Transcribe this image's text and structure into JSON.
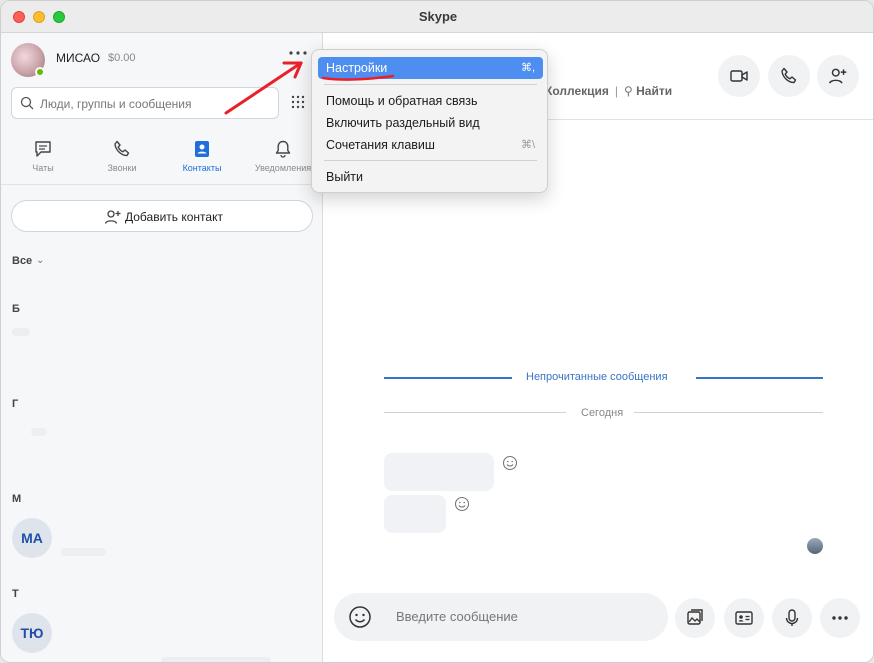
{
  "window": {
    "title": "Skype"
  },
  "profile": {
    "name": "МИСАО",
    "credit": "$0.00"
  },
  "search": {
    "placeholder": "Люди, группы и сообщения"
  },
  "nav": {
    "chats": "Чаты",
    "calls": "Звонки",
    "contacts": "Контакты",
    "notifications": "Уведомления"
  },
  "contacts": {
    "add_label": "Добавить контакт",
    "filter": "Все",
    "letters": [
      "Б",
      "Г",
      "М",
      "Т"
    ],
    "avatars": [
      "МА",
      "ТЮ"
    ]
  },
  "header": {
    "collection": "Коллекция",
    "find": "Найти"
  },
  "chat": {
    "unread_divider": "Непрочитанные сообщения",
    "today_divider": "Сегодня"
  },
  "composer": {
    "placeholder": "Введите сообщение"
  },
  "menu": {
    "settings": "Настройки",
    "settings_shortcut": "⌘,",
    "help": "Помощь и обратная связь",
    "split_view": "Включить раздельный вид",
    "shortcuts": "Сочетания клавиш",
    "shortcuts_shortcut": "⌘\\",
    "signout": "Выйти"
  },
  "colors": {
    "accent": "#1e6fd9",
    "menu_highlight": "#4e8ef0",
    "annotation": "#e8202a"
  }
}
